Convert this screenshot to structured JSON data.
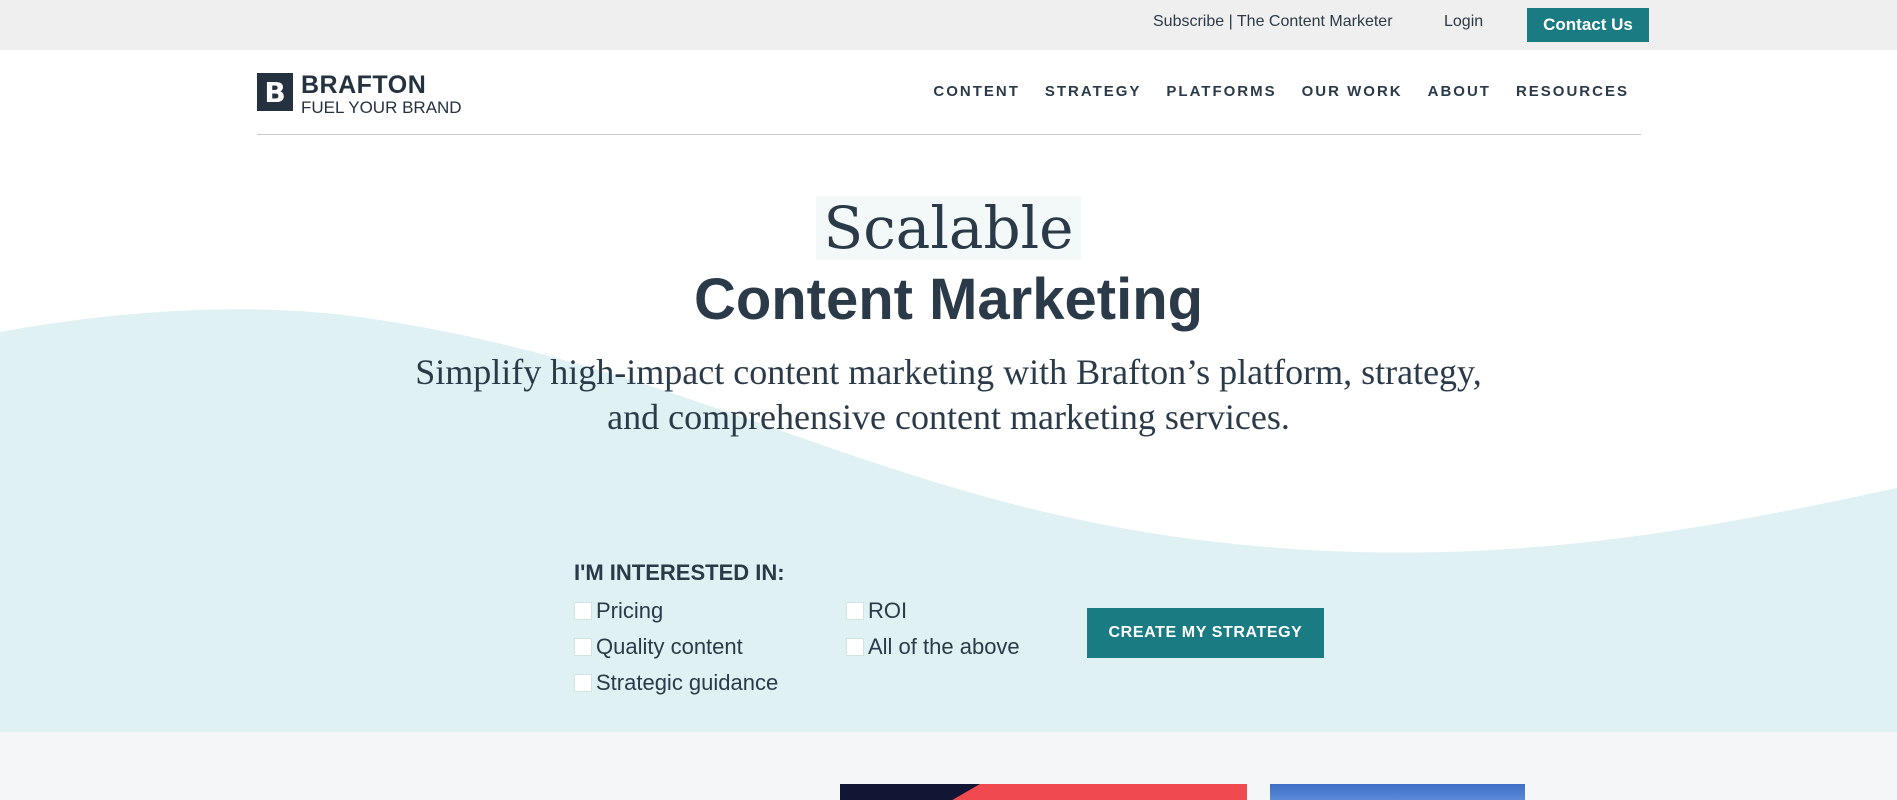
{
  "topbar": {
    "subscribe": "Subscribe | The Content Marketer",
    "login": "Login",
    "contact": "Contact Us"
  },
  "header": {
    "logo_mark": "B",
    "logo_name": "BRAFTON",
    "logo_tagline": "FUEL YOUR BRAND",
    "nav": [
      "CONTENT",
      "STRATEGY",
      "PLATFORMS",
      "OUR WORK",
      "ABOUT",
      "RESOURCES"
    ]
  },
  "hero": {
    "title_line1": "Scalable",
    "title_line2": "Content Marketing",
    "subtitle_line1": "Simplify high-impact content marketing with Brafton’s platform, strategy,",
    "subtitle_line2": "and comprehensive content marketing services."
  },
  "form": {
    "label": "I'M INTERESTED IN:",
    "options": [
      "Pricing",
      "Quality content",
      "Strategic guidance",
      "ROI",
      "All of the above"
    ],
    "submit": "CREATE MY STRATEGY"
  },
  "colors": {
    "accent": "#1b7b82",
    "text": "#2b3a48",
    "wave": "#dff1f3",
    "topbar": "#efefef"
  }
}
